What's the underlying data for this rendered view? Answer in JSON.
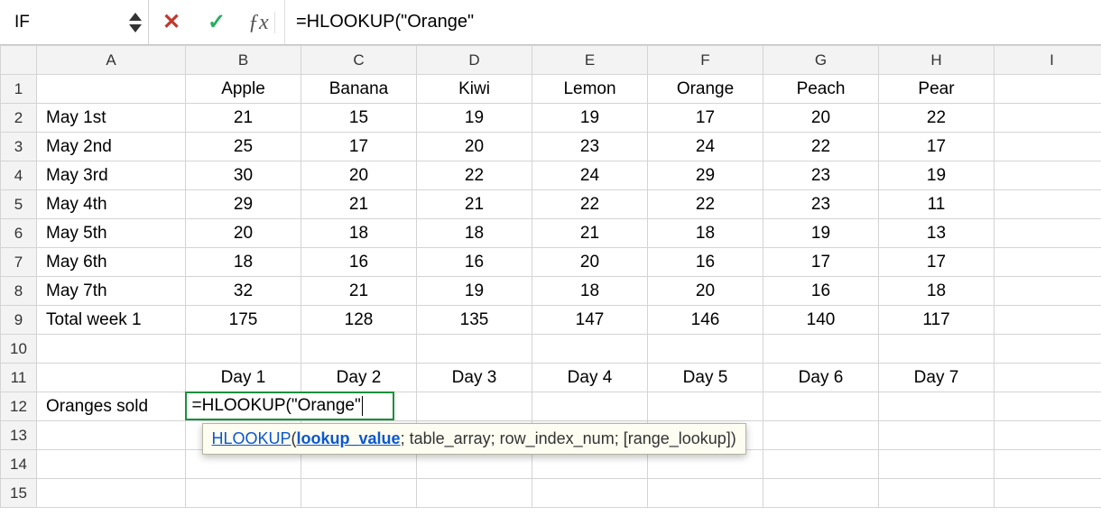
{
  "namebox": {
    "value": "IF"
  },
  "formula_bar": {
    "text": "=HLOOKUP(\"Orange\""
  },
  "columns": [
    "A",
    "B",
    "C",
    "D",
    "E",
    "F",
    "G",
    "H",
    "I"
  ],
  "rows": [
    1,
    2,
    3,
    4,
    5,
    6,
    7,
    8,
    9,
    10,
    11,
    12,
    13,
    14,
    15
  ],
  "cells": {
    "B1": "Apple",
    "C1": "Banana",
    "D1": "Kiwi",
    "E1": "Lemon",
    "F1": "Orange",
    "G1": "Peach",
    "H1": "Pear",
    "A2": "May 1st",
    "B2": "21",
    "C2": "15",
    "D2": "19",
    "E2": "19",
    "F2": "17",
    "G2": "20",
    "H2": "22",
    "A3": "May 2nd",
    "B3": "25",
    "C3": "17",
    "D3": "20",
    "E3": "23",
    "F3": "24",
    "G3": "22",
    "H3": "17",
    "A4": "May 3rd",
    "B4": "30",
    "C4": "20",
    "D4": "22",
    "E4": "24",
    "F4": "29",
    "G4": "23",
    "H4": "19",
    "A5": "May 4th",
    "B5": "29",
    "C5": "21",
    "D5": "21",
    "E5": "22",
    "F5": "22",
    "G5": "23",
    "H5": "11",
    "A6": "May 5th",
    "B6": "20",
    "C6": "18",
    "D6": "18",
    "E6": "21",
    "F6": "18",
    "G6": "19",
    "H6": "13",
    "A7": "May 6th",
    "B7": "18",
    "C7": "16",
    "D7": "16",
    "E7": "20",
    "F7": "16",
    "G7": "17",
    "H7": "17",
    "A8": "May 7th",
    "B8": "32",
    "C8": "21",
    "D8": "19",
    "E8": "18",
    "F8": "20",
    "G8": "16",
    "H8": "18",
    "A9": "Total week 1",
    "B9": "175",
    "C9": "128",
    "D9": "135",
    "E9": "147",
    "F9": "146",
    "G9": "140",
    "H9": "117",
    "B11": "Day 1",
    "C11": "Day 2",
    "D11": "Day 3",
    "E11": "Day 4",
    "F11": "Day 5",
    "G11": "Day 6",
    "H11": "Day 7",
    "A12": "Oranges sold"
  },
  "edit": {
    "text": "=HLOOKUP(\"Orange\""
  },
  "tooltip": {
    "fn": "HLOOKUP",
    "arg1": "lookup_value",
    "rest": "; table_array; row_index_num; [range_lookup])"
  }
}
